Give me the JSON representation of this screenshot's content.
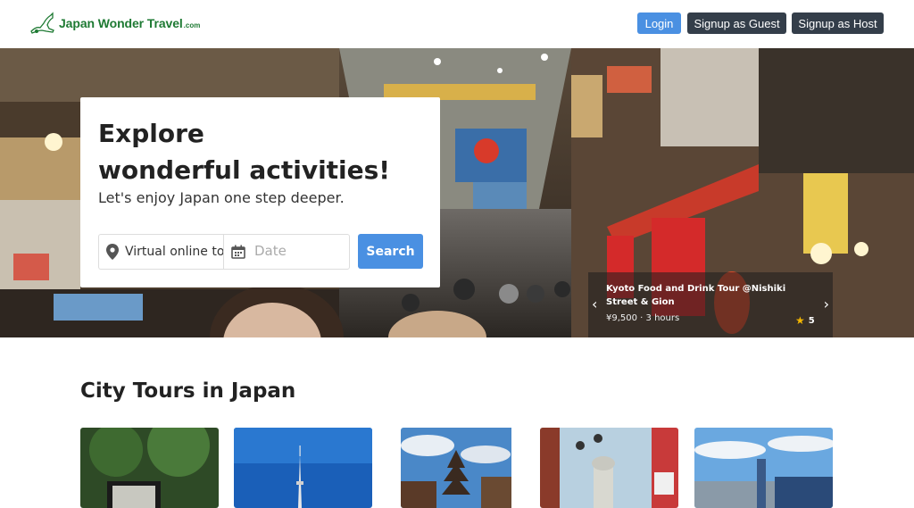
{
  "header": {
    "logo_text": "Japan Wonder Travel",
    "logo_suffix": ".com",
    "login_label": "Login",
    "guest_label": "Signup as Guest",
    "host_label": "Signup as Host"
  },
  "hero": {
    "headline_line1": "Explore",
    "headline_line2": "wonderful activities!",
    "subheadline": "Let's enjoy Japan one step deeper.",
    "location_value": "Virtual online to",
    "date_placeholder": "Date",
    "search_label": "Search",
    "featured_tour": {
      "title": "Kyoto Food and Drink Tour @Nishiki Street & Gion",
      "meta": "¥9,500 · 3 hours",
      "rating": "5"
    }
  },
  "section": {
    "title": "City Tours in Japan",
    "cards": [
      {
        "icon": "photo"
      },
      {
        "icon": "photo"
      },
      {
        "icon": "photo"
      },
      {
        "icon": "photo"
      },
      {
        "icon": "photo"
      }
    ]
  },
  "colors": {
    "brand_green": "#1e7a33",
    "primary_blue": "#4a90e2",
    "dark_button": "#343e4a"
  }
}
